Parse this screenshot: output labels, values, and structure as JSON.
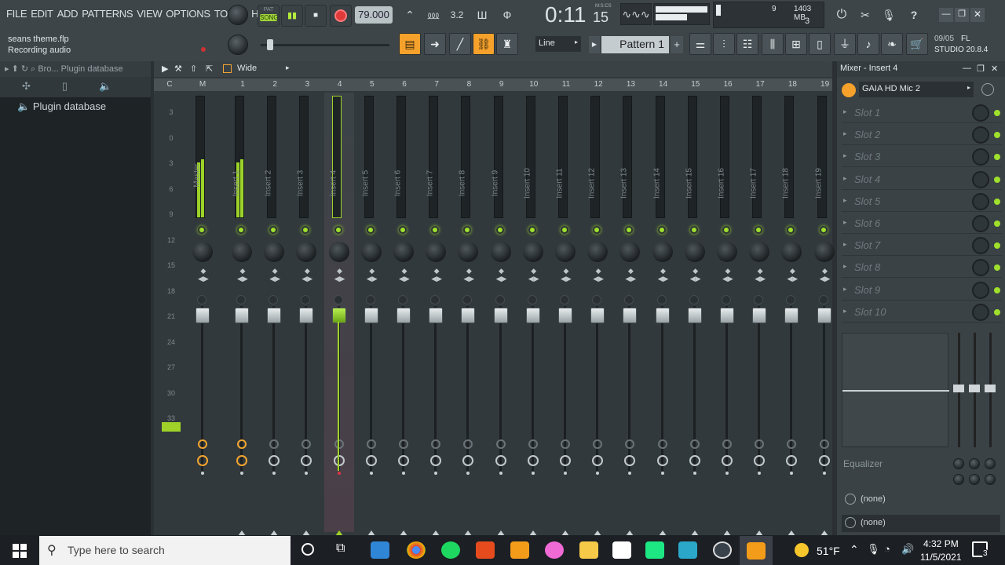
{
  "menu": [
    "FILE",
    "EDIT",
    "ADD",
    "PATTERNS",
    "VIEW",
    "OPTIONS",
    "TOOLS",
    "HELP"
  ],
  "hint": {
    "file": "seans theme.flp",
    "status": "Recording audio"
  },
  "transport": {
    "mode_pat": "PAT",
    "mode_song": "SONG",
    "tempo": "79.000",
    "time": "0:11",
    "time_sub": "15",
    "time_unit": "M:S:CS"
  },
  "cpu": {
    "cores": "9",
    "memory": "1403 MB",
    "voices": "3"
  },
  "toolbar2": {
    "snap": "Line",
    "pattern": "Pattern 1",
    "plus": "+"
  },
  "news": {
    "date": "09/05",
    "line1": "FL",
    "line2": "STUDIO 20.8.4"
  },
  "browser": {
    "path": "Bro... Plugin database",
    "item": "Plugin database"
  },
  "mixer": {
    "view_mode": "Wide",
    "col_c": "C",
    "col_m": "M",
    "numbers": [
      "1",
      "2",
      "3",
      "4",
      "5",
      "6",
      "7",
      "8",
      "9",
      "10",
      "11",
      "12",
      "13",
      "14",
      "15",
      "16",
      "17",
      "18",
      "19"
    ],
    "db_scale": [
      "3",
      "0",
      "3",
      "6",
      "9",
      "12",
      "15",
      "18",
      "21",
      "24",
      "27",
      "30",
      "33"
    ],
    "tracks": [
      "Master",
      "Insert 1",
      "Insert 2",
      "Insert 3",
      "Insert 4",
      "Insert 5",
      "Insert 6",
      "Insert 7",
      "Insert 8",
      "Insert 9",
      "Insert 10",
      "Insert 11",
      "Insert 12",
      "Insert 13",
      "Insert 14",
      "Insert 15",
      "Insert 16",
      "Insert 17",
      "Insert 18",
      "Insert 19"
    ],
    "selected_track": "Insert 4"
  },
  "insert_panel": {
    "title": "Mixer - Insert 4",
    "input": "GAIA HD Mic 2",
    "slots": [
      "Slot 1",
      "Slot 2",
      "Slot 3",
      "Slot 4",
      "Slot 5",
      "Slot 6",
      "Slot 7",
      "Slot 8",
      "Slot 9",
      "Slot 10"
    ],
    "eq_label": "Equalizer",
    "out1": "(none)",
    "out2": "(none)"
  },
  "taskbar": {
    "search_placeholder": "Type here to search",
    "weather": "51°F",
    "time": "4:32 PM",
    "date": "11/5/2021",
    "notifications": "3"
  }
}
